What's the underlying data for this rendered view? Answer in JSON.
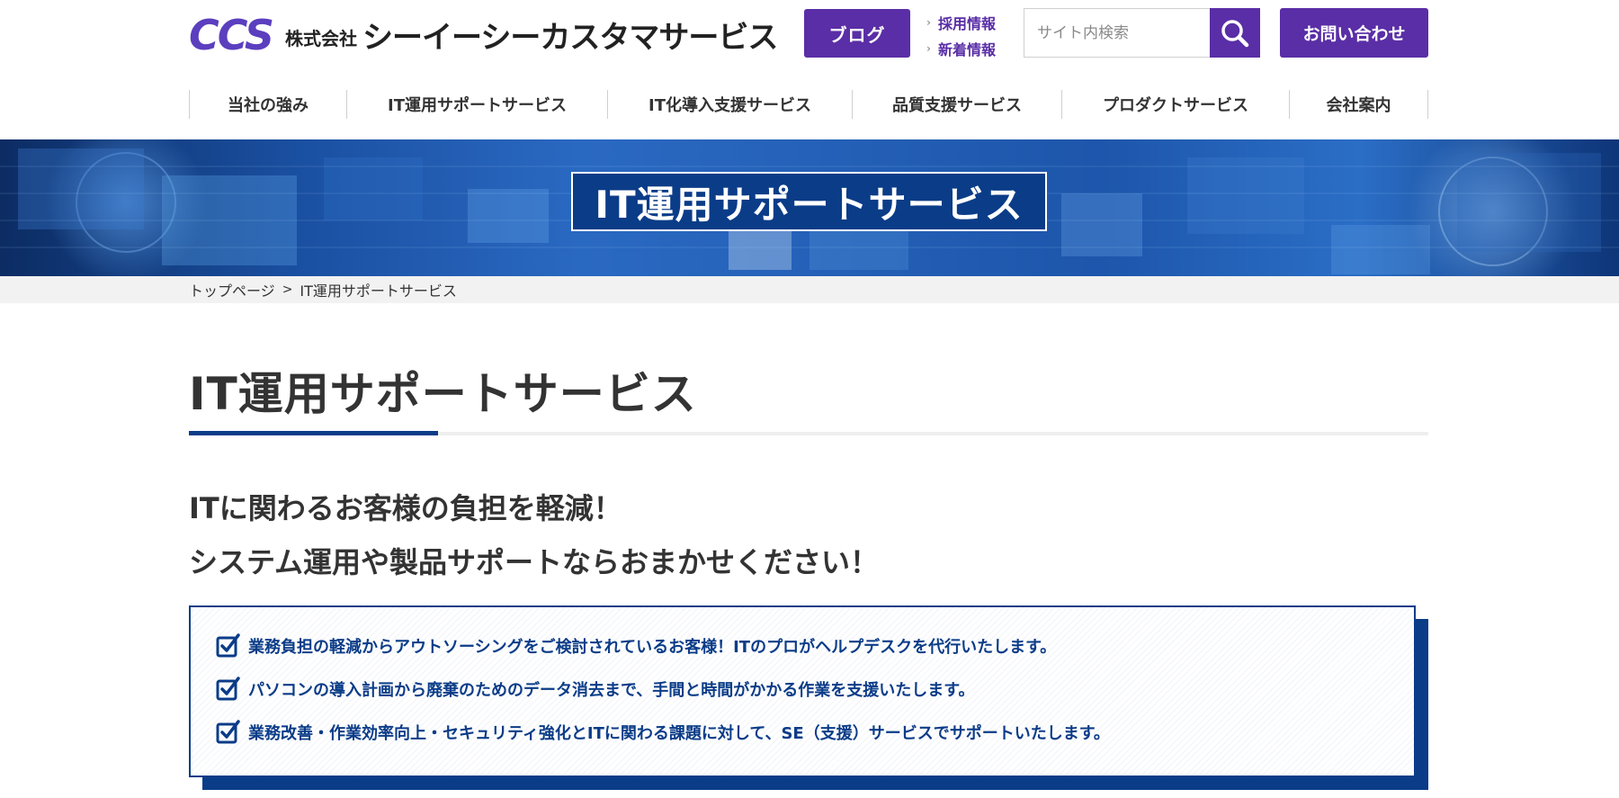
{
  "header": {
    "logo_mark": "CCS",
    "logo_corp": "株式会社",
    "logo_name": "シーイーシーカスタマサービス",
    "blog_label": "ブログ",
    "sublinks": [
      "採用情報",
      "新着情報"
    ],
    "search": {
      "placeholder": "サイト内検索",
      "icon": "search-icon"
    },
    "contact_label": "お問い合わせ"
  },
  "nav": {
    "items": [
      {
        "label": "当社の強み"
      },
      {
        "label": "IT運用サポートサービス"
      },
      {
        "label": "IT化導入支援サービス"
      },
      {
        "label": "品質支援サービス"
      },
      {
        "label": "プロダクトサービス"
      },
      {
        "label": "会社案内"
      }
    ]
  },
  "hero": {
    "title": "IT運用サポートサービス"
  },
  "breadcrumb": {
    "home": "トップページ",
    "current": "IT運用サポートサービス"
  },
  "main": {
    "title": "IT運用サポートサービス",
    "lead_lines": [
      "ITに関わるお客様の負担を軽減！",
      "システム運用や製品サポートならおまかせください！"
    ],
    "points": [
      "業務負担の軽減からアウトソーシングをご検討されているお客様！ITのプロがヘルプデスクを代行いたします。",
      "パソコンの導入計画から廃棄のためのデータ消去まで、手間と時間がかかる作業を支援いたします。",
      "業務改善・作業効率向上・セキュリティ強化とITに関わる課題に対して、SE（支援）サービスでサポートいたします。"
    ]
  },
  "colors": {
    "brand_purple": "#5a2ea6",
    "navy": "#0b3c88",
    "text": "#333333"
  }
}
